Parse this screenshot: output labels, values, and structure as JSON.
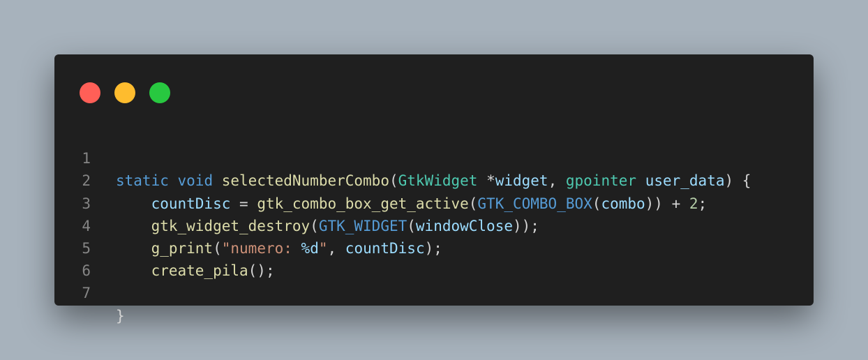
{
  "window": {
    "controls": [
      {
        "name": "close",
        "color": "#ff5f57"
      },
      {
        "name": "minimize",
        "color": "#febc2e"
      },
      {
        "name": "maximize",
        "color": "#28c840"
      }
    ]
  },
  "palette": {
    "keyword": "#569cd6",
    "type": "#4ec9b0",
    "function": "#dcdcaa",
    "variable": "#9cdcfe",
    "string": "#ce9178",
    "format": "#9cdcfe",
    "number": "#b5cea8",
    "macro": "#569cd6",
    "plain": "#d4d4d4"
  },
  "code": {
    "lines": [
      {
        "number": "1",
        "tokens": [
          {
            "text": "static",
            "kind": "keyword"
          },
          {
            "text": " ",
            "kind": "plain"
          },
          {
            "text": "void",
            "kind": "keyword"
          },
          {
            "text": " ",
            "kind": "plain"
          },
          {
            "text": "selectedNumberCombo",
            "kind": "function"
          },
          {
            "text": "(",
            "kind": "plain"
          },
          {
            "text": "GtkWidget",
            "kind": "type"
          },
          {
            "text": " *",
            "kind": "plain"
          },
          {
            "text": "widget",
            "kind": "variable"
          },
          {
            "text": ", ",
            "kind": "plain"
          },
          {
            "text": "gpointer",
            "kind": "type"
          },
          {
            "text": " ",
            "kind": "plain"
          },
          {
            "text": "user_data",
            "kind": "variable"
          },
          {
            "text": ") {",
            "kind": "plain"
          }
        ]
      },
      {
        "number": "2",
        "tokens": [
          {
            "text": "    ",
            "kind": "plain"
          },
          {
            "text": "countDisc",
            "kind": "variable"
          },
          {
            "text": " = ",
            "kind": "plain"
          },
          {
            "text": "gtk_combo_box_get_active",
            "kind": "function"
          },
          {
            "text": "(",
            "kind": "plain"
          },
          {
            "text": "GTK_COMBO_BOX",
            "kind": "macro"
          },
          {
            "text": "(",
            "kind": "plain"
          },
          {
            "text": "combo",
            "kind": "variable"
          },
          {
            "text": ")) + ",
            "kind": "plain"
          },
          {
            "text": "2",
            "kind": "number"
          },
          {
            "text": ";",
            "kind": "plain"
          }
        ]
      },
      {
        "number": "3",
        "tokens": [
          {
            "text": "    ",
            "kind": "plain"
          },
          {
            "text": "gtk_widget_destroy",
            "kind": "function"
          },
          {
            "text": "(",
            "kind": "plain"
          },
          {
            "text": "GTK_WIDGET",
            "kind": "macro"
          },
          {
            "text": "(",
            "kind": "plain"
          },
          {
            "text": "windowClose",
            "kind": "variable"
          },
          {
            "text": "));",
            "kind": "plain"
          }
        ]
      },
      {
        "number": "4",
        "tokens": [
          {
            "text": "    ",
            "kind": "plain"
          },
          {
            "text": "g_print",
            "kind": "function"
          },
          {
            "text": "(",
            "kind": "plain"
          },
          {
            "text": "\"numero: ",
            "kind": "string"
          },
          {
            "text": "%d",
            "kind": "format"
          },
          {
            "text": "\"",
            "kind": "string"
          },
          {
            "text": ", ",
            "kind": "plain"
          },
          {
            "text": "countDisc",
            "kind": "variable"
          },
          {
            "text": ");",
            "kind": "plain"
          }
        ]
      },
      {
        "number": "5",
        "tokens": [
          {
            "text": "    ",
            "kind": "plain"
          },
          {
            "text": "create_pila",
            "kind": "function"
          },
          {
            "text": "();",
            "kind": "plain"
          }
        ]
      },
      {
        "number": "6",
        "tokens": []
      },
      {
        "number": "7",
        "tokens": [
          {
            "text": "}",
            "kind": "plain"
          }
        ]
      }
    ]
  }
}
